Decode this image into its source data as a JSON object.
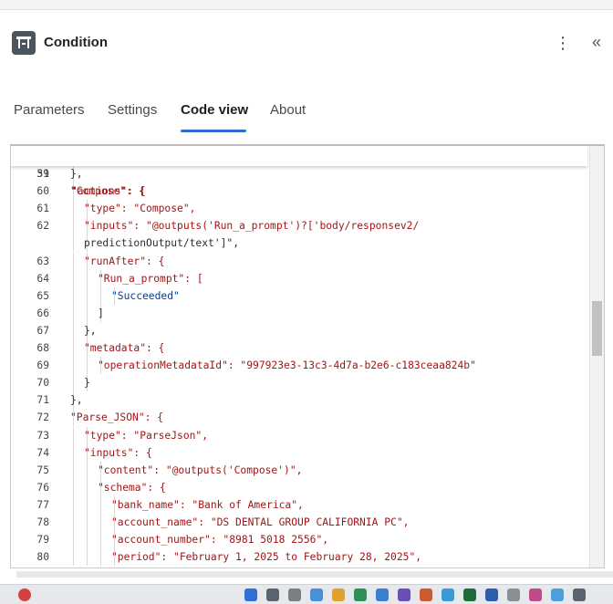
{
  "panel": {
    "title": "Condition",
    "more_glyph": "⋮",
    "collapse_glyph": "«"
  },
  "tabs": [
    {
      "label": "Parameters",
      "active": false
    },
    {
      "label": "Settings",
      "active": false
    },
    {
      "label": "Code view",
      "active": true
    },
    {
      "label": "About",
      "active": false
    }
  ],
  "sticky_line": {
    "num": "31",
    "text": "\"actions\": {"
  },
  "code_lines": [
    {
      "num": "59",
      "indent": 2,
      "text": "},"
    },
    {
      "num": "60",
      "indent": 2,
      "text": "\"Compose\": {"
    },
    {
      "num": "61",
      "indent": 3,
      "text": "\"type\": \"Compose\","
    },
    {
      "num": "62",
      "indent": 3,
      "text": "\"inputs\": \"@outputs('Run_a_prompt')?['body/responsev2/"
    },
    {
      "num": "",
      "indent": 3,
      "text": "predictionOutput/text']\","
    },
    {
      "num": "63",
      "indent": 3,
      "text": "\"runAfter\": {"
    },
    {
      "num": "64",
      "indent": 4,
      "text": "\"Run_a_prompt\": ["
    },
    {
      "num": "65",
      "indent": 5,
      "text": "\"Succeeded\""
    },
    {
      "num": "66",
      "indent": 4,
      "text": "]"
    },
    {
      "num": "67",
      "indent": 3,
      "text": "},"
    },
    {
      "num": "68",
      "indent": 3,
      "text": "\"metadata\": {"
    },
    {
      "num": "69",
      "indent": 4,
      "text": "\"operationMetadataId\": \"997923e3-13c3-4d7a-b2e6-c183ceaa824b\""
    },
    {
      "num": "70",
      "indent": 3,
      "text": "}"
    },
    {
      "num": "71",
      "indent": 2,
      "text": "},"
    },
    {
      "num": "72",
      "indent": 2,
      "text": "\"Parse_JSON\": {"
    },
    {
      "num": "73",
      "indent": 3,
      "text": "\"type\": \"ParseJson\","
    },
    {
      "num": "74",
      "indent": 3,
      "text": "\"inputs\": {"
    },
    {
      "num": "75",
      "indent": 4,
      "text": "\"content\": \"@outputs('Compose')\","
    },
    {
      "num": "76",
      "indent": 4,
      "text": "\"schema\": {"
    },
    {
      "num": "77",
      "indent": 5,
      "text": "\"bank_name\": \"Bank of America\","
    },
    {
      "num": "78",
      "indent": 5,
      "text": "\"account_name\": \"DS DENTAL GROUP CALIFORNIA PC\","
    },
    {
      "num": "79",
      "indent": 5,
      "text": "\"account_number\": \"8981 5018 2556\","
    },
    {
      "num": "80",
      "indent": 5,
      "text": "\"period\": \"February 1, 2025 to February 28, 2025\","
    }
  ],
  "colors": {
    "accent": "#2b6fd6",
    "key": "#a31515",
    "string": "#0b3a8a"
  }
}
